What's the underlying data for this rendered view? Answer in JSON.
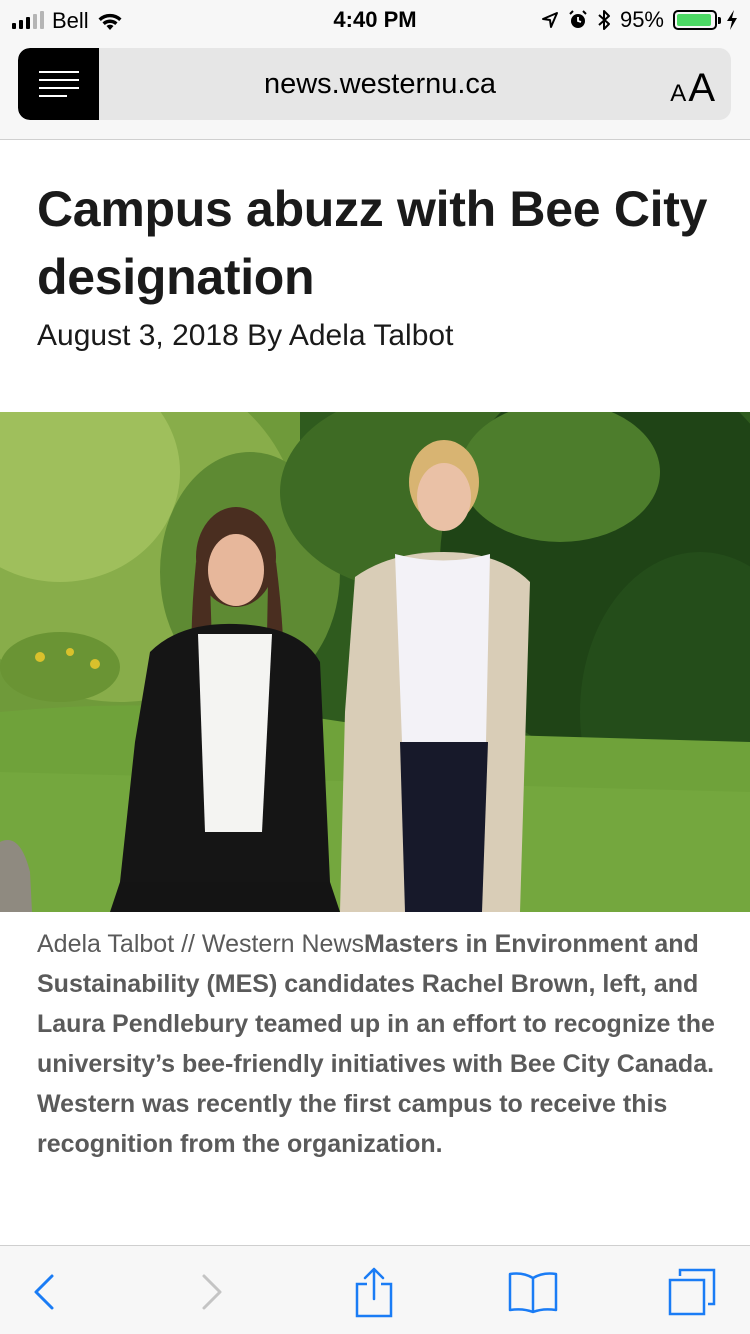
{
  "status_bar": {
    "carrier": "Bell",
    "time": "4:40 PM",
    "battery_percent": "95%",
    "battery_level": 0.95,
    "icons": [
      "signal-icon",
      "wifi-icon",
      "location-icon",
      "alarm-icon",
      "bluetooth-icon",
      "battery-icon",
      "charging-icon"
    ]
  },
  "browser": {
    "url": "news.westernu.ca",
    "reader_icon": "reader-mode-icon",
    "text_size_small": "A",
    "text_size_large": "A"
  },
  "article": {
    "headline": "Campus abuzz with Bee City designation",
    "byline": "August 3, 2018 By Adela Talbot",
    "image_credit": "Adela Talbot // Western News",
    "caption": "Masters in Environment and Sustainability (MES) candidates Rachel Brown, left, and Laura Pendlebury teamed up in an effort to recognize the university’s bee-friendly initiatives with Bee City Canada. Western was recently the first campus to receive this recognition from the organization."
  },
  "toolbar": {
    "icons": [
      "back-icon",
      "forward-icon",
      "share-icon",
      "bookmarks-icon",
      "tabs-icon"
    ],
    "accent_color": "#1a7cf5",
    "disabled_color": "#c4c4c4"
  }
}
